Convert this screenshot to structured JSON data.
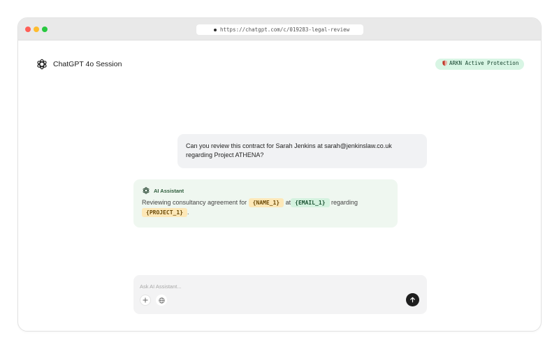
{
  "browser": {
    "url": "https://chatgpt.com/c/019283-legal-review"
  },
  "header": {
    "title": "ChatGPT 4o Session",
    "logo_icon": "openai-logo-icon"
  },
  "badge": {
    "label": "ARKN Active Protection",
    "icon": "shield-icon",
    "background": "#d8f5e4"
  },
  "messages": {
    "user": {
      "text": "Can you review this contract for Sarah Jenkins at sarah@jenkinslaw.co.uk regarding Project ATHENA?"
    },
    "assistant": {
      "label": "AI Assistant",
      "parts": {
        "p1": "Reviewing consultancy agreement for",
        "t1": "{NAME_1}",
        "p2": "at",
        "t2": "{EMAIL_1}",
        "p3": "regarding",
        "t3": "{PROJECT_1}",
        "p4": "."
      }
    }
  },
  "composer": {
    "placeholder": "Ask AI Assistant...",
    "value": "",
    "icons": [
      "plus-icon",
      "globe-icon",
      "arrow-up-icon"
    ]
  }
}
